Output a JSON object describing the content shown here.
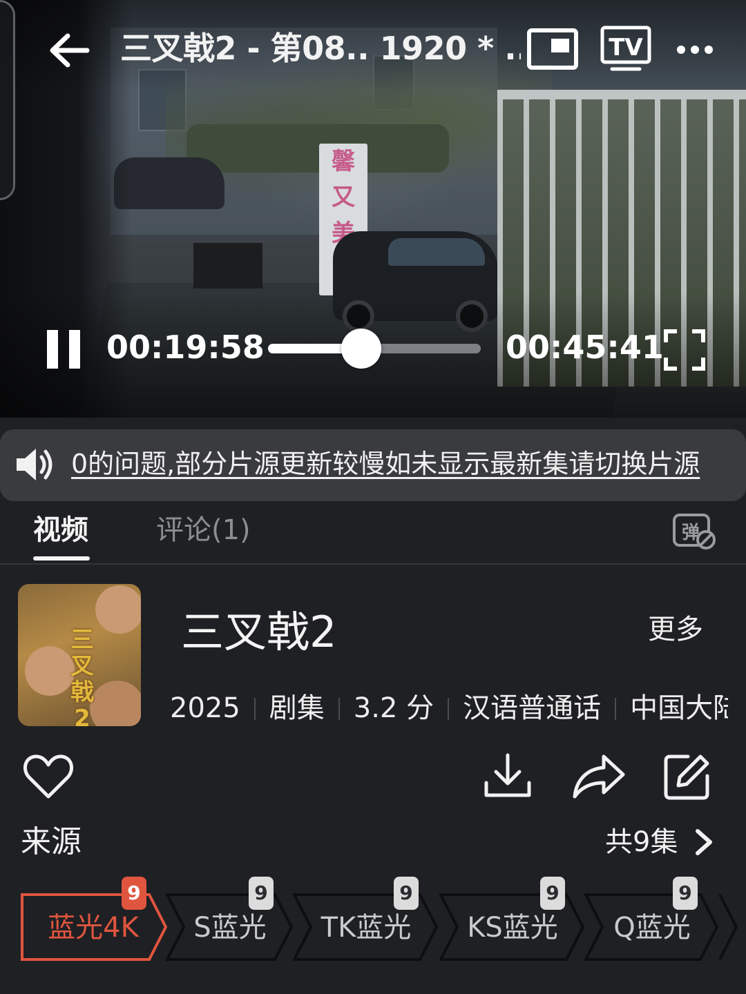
{
  "player": {
    "title": "三叉戟2 - 第08.. 1920 * ...",
    "tv_label": "TV",
    "current_time": "00:19:58",
    "total_time": "00:45:41",
    "progress": 0.437,
    "scene_sign_text": [
      "馨",
      "又",
      "美"
    ]
  },
  "notice": {
    "text": "0的问题,部分片源更新较慢如未显示最新集请切换片源"
  },
  "tabs": [
    {
      "label": "视频"
    },
    {
      "label": "评论(1)"
    }
  ],
  "danmaku_label": "弹",
  "show": {
    "poster_title": "三叉戟2",
    "title": "三叉戟2",
    "more_label": "更多",
    "meta": [
      "2025",
      "剧集",
      "3.2 分",
      "汉语普通话",
      "中国大陆"
    ]
  },
  "source_section": {
    "label": "来源",
    "episode_count": "共9集",
    "sources": [
      {
        "label": "蓝光4K",
        "badge": "9",
        "active": true
      },
      {
        "label": "S蓝光",
        "badge": "9",
        "active": false
      },
      {
        "label": "TK蓝光",
        "badge": "9",
        "active": false
      },
      {
        "label": "KS蓝光",
        "badge": "9",
        "active": false
      },
      {
        "label": "Q蓝光",
        "badge": "9",
        "active": false
      }
    ]
  },
  "colors": {
    "background": "#1f2023",
    "accent": "#e0553f",
    "notice_bg": "#3a3b3f"
  }
}
